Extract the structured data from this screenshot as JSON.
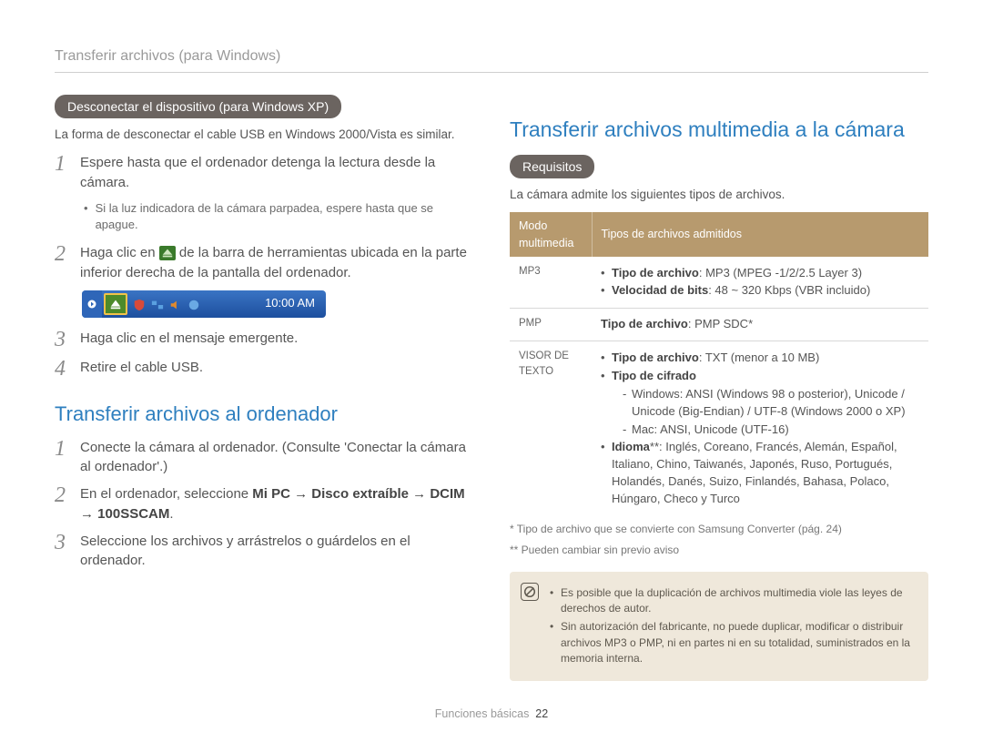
{
  "header": "Transferir archivos (para Windows)",
  "left": {
    "pill1": "Desconectar el dispositivo (para Windows XP)",
    "intro1": "La forma de desconectar el cable USB en Windows 2000/Vista es similar.",
    "steps1": {
      "s1": "Espere hasta que el ordenador detenga la lectura desde la cámara.",
      "s1_bullet": "Si la luz indicadora de la cámara parpadea, espere hasta que se apague.",
      "s2_a": "Haga clic en ",
      "s2_b": " de la barra de herramientas ubicada en la parte inferior derecha de la pantalla del ordenador.",
      "s3": "Haga clic en el mensaje emergente.",
      "s4": "Retire el cable USB."
    },
    "taskbar_time": "10:00 AM",
    "title2": "Transferir archivos al ordenador",
    "steps2": {
      "s1": "Conecte la cámara al ordenador. (Consulte 'Conectar la cámara al ordenador'.)",
      "s2_a": "En el ordenador, seleccione ",
      "s2_b": "Mi PC → Disco extraíble → DCIM → 100SSCAM",
      "s2_c": ".",
      "s3": "Seleccione los archivos y arrástrelos o guárdelos en el ordenador."
    }
  },
  "right": {
    "title": "Transferir archivos multimedia a la cámara",
    "pill": "Requisitos",
    "intro": "La cámara admite los siguientes tipos de archivos.",
    "th1": "Modo multimedia",
    "th2": "Tipos de archivos admitidos",
    "rows": {
      "mp3": {
        "label": "MP3",
        "l1a": "Tipo de archivo",
        "l1b": ": MP3 (MPEG -1/2/2.5 Layer 3)",
        "l2a": "Velocidad de bits",
        "l2b": ": 48 ~ 320 Kbps (VBR incluido)"
      },
      "pmp": {
        "label": "PMP",
        "l1a": "Tipo de archivo",
        "l1b": ": PMP SDC*"
      },
      "txt": {
        "label": "VISOR DE TEXTO",
        "l1a": "Tipo de archivo",
        "l1b": ": TXT (menor a 10 MB)",
        "l2a": "Tipo de cifrado",
        "d1": "Windows: ANSI (Windows 98 o posterior), Unicode / Unicode (Big-Endian) / UTF-8 (Windows 2000 o XP)",
        "d2": "Mac: ANSI, Unicode (UTF-16)",
        "l3a": "Idioma",
        "l3b": "**: Inglés, Coreano, Francés, Alemán, Español, Italiano, Chino, Taiwanés, Japonés, Ruso, Portugués, Holandés, Danés, Suizo, Finlandés, Bahasa, Polaco, Húngaro, Checo y Turco"
      }
    },
    "fn1": "* Tipo de archivo que se convierte con Samsung Converter (pág. 24)",
    "fn2": "** Pueden cambiar sin previo aviso",
    "note1": "Es posible que la duplicación de archivos multimedia viole las leyes de derechos de autor.",
    "note2": "Sin autorización del fabricante, no puede duplicar, modificar o distribuir archivos MP3 o PMP, ni en partes ni en su totalidad, suministrados en la memoria interna."
  },
  "footer": {
    "section": "Funciones básicas",
    "page": "22"
  }
}
